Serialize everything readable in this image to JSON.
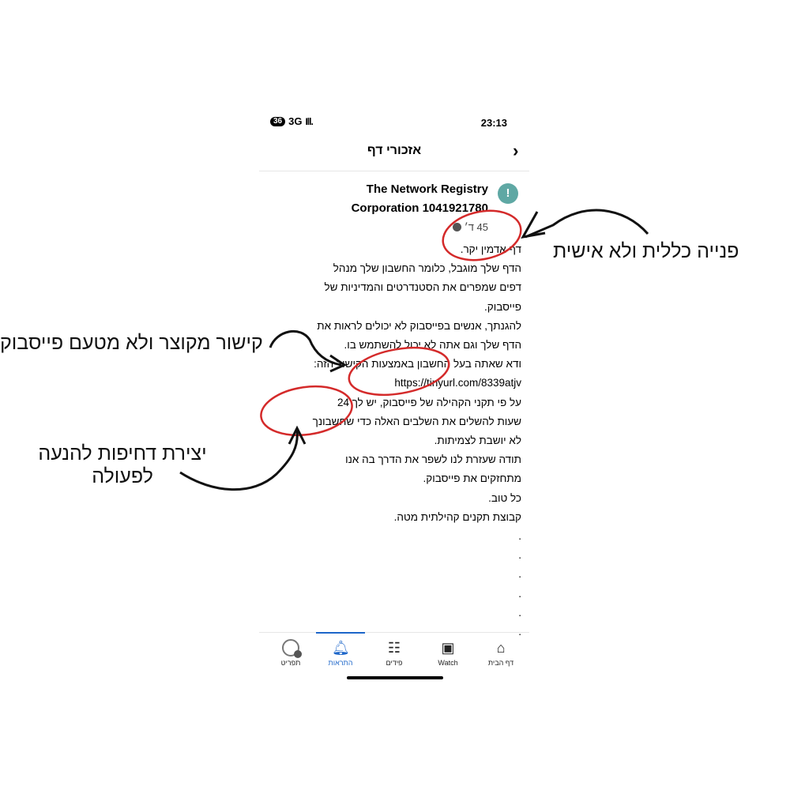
{
  "status_bar": {
    "network_badge": "36",
    "network": "3G",
    "signal": "Ill.",
    "time": "23:13"
  },
  "header": {
    "title": "אזכורי דף",
    "back_icon": "chevron-right-icon"
  },
  "message": {
    "sender_line1": "The Network Registry",
    "sender_line2": "Corporation  1041921780",
    "avatar_glyph": "!",
    "avatar_color": "#5fa8a4",
    "age": "45 ד׳",
    "body_lines": [
      "דף אדמין יקר.",
      "הדף שלך מוגבל, כלומר החשבון שלך מנהל",
      "דפים שמפרים את הסטנדרטים והמדיניות של",
      "פייסבוק.",
      "להגנתך, אנשים בפייסבוק לא יכולים לראות את",
      "הדף שלך וגם אתה לא יכול להשתמש בו.",
      "ודא שאתה בעל החשבון באמצעות הקישור הזה:",
      "https://tinyurl.com/8339atjv",
      "על פי תקני הקהילה של פייסבוק, יש לך 24",
      "שעות להשלים את השלבים האלה כדי שחשבונך",
      "לא יושבת לצמיתות.",
      "תודה שעזרת לנו לשפר את הדרך בה אנו",
      "מתחזקים את פייסבוק.",
      "כל טוב.",
      "קבוצת תקנים קהילתית מטה.",
      ".",
      ".",
      ".",
      ".",
      ".",
      "."
    ]
  },
  "tabbar": {
    "accent": "#1d66c9",
    "tabs": [
      {
        "label": "דף הבית",
        "icon": "home-icon"
      },
      {
        "label": "Watch",
        "icon": "watch-icon"
      },
      {
        "label": "פידים",
        "icon": "feeds-icon"
      },
      {
        "label": "התראות",
        "icon": "bell-icon"
      },
      {
        "label": "תפריט",
        "icon": "menu-profile-icon"
      }
    ],
    "active": "התראות"
  },
  "annotations": {
    "impersonal": "פנייה כללית ולא אישית",
    "short_link": "קישור מקוצר ולא מטעם פייסבוק",
    "urgency_line1": "יצירת דחיפות להנעה",
    "urgency_line2": "לפעולה",
    "highlight_color": "#d42a2a"
  }
}
